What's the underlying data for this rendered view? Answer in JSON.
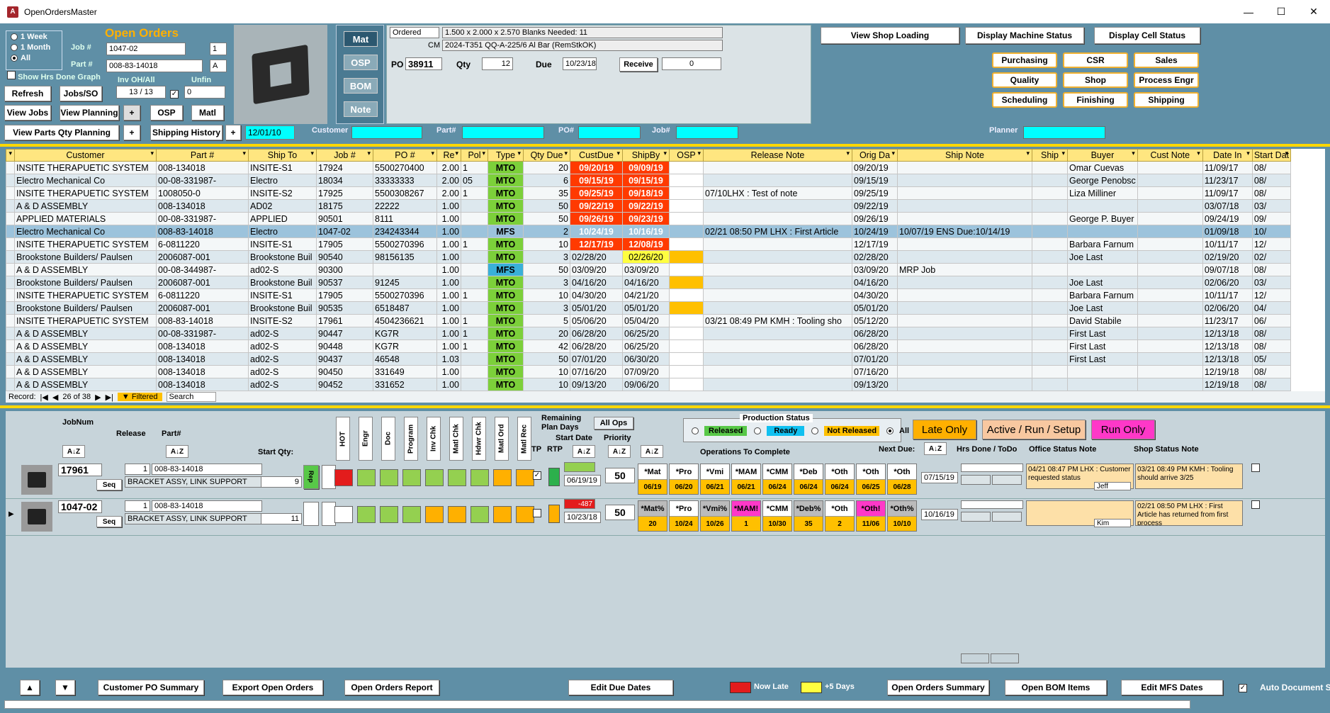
{
  "app": {
    "title": "OpenOrdersMaster",
    "icon": "A"
  },
  "filters": {
    "radio_1week": "1 Week",
    "radio_1month": "1 Month",
    "radio_all": "All",
    "show_hrs": "Show Hrs Done Graph",
    "job_label": "Job #",
    "job_value": "1047-02",
    "job_suffix": "1",
    "part_label": "Part #",
    "part_value": "008-83-14018",
    "part_suffix": "A",
    "inv_label": "Inv OH/All",
    "inv_value": "13 / 13",
    "unfin_label": "Unfin",
    "unfin_value": "0",
    "date_value": "12/01/10",
    "customer_label": "Customer",
    "partnum_label": "Part#",
    "ponum_label": "PO#",
    "jobnum_label": "Job#",
    "planner_label": "Planner"
  },
  "title": "Open Orders",
  "buttons": {
    "refresh": "Refresh",
    "jobs_so": "Jobs/SO",
    "view_jobs": "View Jobs",
    "view_planning": "View Planning",
    "plus": "+",
    "osp": "OSP",
    "matl": "Matl",
    "view_parts_qty": "View Parts Qty Planning",
    "shipping_history": "Shipping History",
    "view_shop_loading": "View Shop Loading",
    "display_machine_status": "Display Machine Status",
    "display_cell_status": "Display Cell Status",
    "receive": "Receive"
  },
  "side_tabs": [
    "Mat",
    "OSP",
    "BOM",
    "Note"
  ],
  "po_panel": {
    "status": "Ordered",
    "spec": "1.500  x 2.000  x 2.570  Blanks Needed: 11",
    "cm_label": "CM",
    "material": "2024-T351 QQ-A-225/6 Al Bar (RemStkOK)",
    "po_label": "PO",
    "po_value": "38911",
    "qty_label": "Qty",
    "qty_value": "12",
    "due_label": "Due",
    "due_value": "10/23/18",
    "recv_value": "0"
  },
  "dept_buttons": [
    "Purchasing",
    "CSR",
    "Sales",
    "Quality",
    "Shop",
    "Process Engr",
    "Scheduling",
    "Finishing",
    "Shipping"
  ],
  "grid": {
    "headers": [
      "Customer",
      "Part #",
      "Ship To",
      "Job #",
      "PO #",
      "Re",
      "Pol",
      "Type",
      "Qty Due",
      "CustDue",
      "ShipBy",
      "OSP",
      "Release Note",
      "Orig Da",
      "Ship Note",
      "Ship",
      "Buyer",
      "Cust Note",
      "Date In",
      "Start Dat"
    ],
    "rows": [
      [
        "INSITE THERAPUETIC SYSTEM",
        "008-134018",
        "INSITE-S1",
        "17924",
        "5500270400",
        "2.00",
        "1",
        "MTO",
        "20",
        "09/20/19",
        "09/09/19",
        "",
        "",
        "09/20/19",
        "",
        "",
        "Omar Cuevas",
        "",
        "11/09/17",
        "08/"
      ],
      [
        "Electro Mechanical Co",
        "00-08-331987-",
        "Electro",
        "18034",
        "33333333",
        "2.00",
        "05",
        "MTO",
        "6",
        "09/15/19",
        "09/15/19",
        "",
        "",
        "09/15/19",
        "",
        "",
        "George Penobsc",
        "",
        "11/23/17",
        "08/"
      ],
      [
        "INSITE THERAPUETIC SYSTEM",
        "1008050-0",
        "INSITE-S2",
        "17925",
        "5500308267",
        "2.00",
        "1",
        "MTO",
        "35",
        "09/25/19",
        "09/18/19",
        "",
        "07/10LHX : Test of note",
        "09/25/19",
        "",
        "",
        "Liza Milliner",
        "",
        "11/09/17",
        "08/"
      ],
      [
        "A & D  ASSEMBLY",
        "008-134018",
        "AD02",
        "18175",
        "22222",
        "1.00",
        "",
        "MTO",
        "50",
        "09/22/19",
        "09/22/19",
        "",
        "",
        "09/22/19",
        "",
        "",
        "",
        "",
        "03/07/18",
        "03/"
      ],
      [
        "APPLIED MATERIALS",
        "00-08-331987-",
        "APPLIED",
        "90501",
        "8111",
        "1.00",
        "",
        "MTO",
        "50",
        "09/26/19",
        "09/23/19",
        "",
        "",
        "09/26/19",
        "",
        "",
        "George P. Buyer",
        "",
        "09/24/19",
        "09/"
      ],
      [
        "Electro Mechanical Co",
        "008-83-14018",
        "Electro",
        "1047-02",
        "234243344",
        "1.00",
        "",
        "MFS",
        "2",
        "10/24/19",
        "10/16/19",
        "",
        "02/21 08:50 PM LHX :  First Article",
        "10/24/19",
        "10/07/19 ENS Due:10/14/19",
        "",
        "",
        "",
        "01/09/18",
        "10/"
      ],
      [
        "INSITE THERAPUETIC SYSTEM",
        "6-0811220",
        "INSITE-S1",
        "17905",
        "5500270396",
        "1.00",
        "1",
        "MTO",
        "10",
        "12/17/19",
        "12/08/19",
        "",
        "",
        "12/17/19",
        "",
        "",
        "Barbara Farnum",
        "",
        "10/11/17",
        "12/"
      ],
      [
        "Brookstone Builders/ Paulsen",
        "2006087-001",
        "Brookstone Buil",
        "90540",
        "98156135",
        "1.00",
        "",
        "MTO",
        "3",
        "02/28/20",
        "02/26/20",
        "",
        "",
        "02/28/20",
        "",
        "",
        "Joe Last",
        "",
        "02/19/20",
        "02/"
      ],
      [
        "A & D  ASSEMBLY",
        "00-08-344987-",
        "ad02-S",
        "90300",
        "",
        "1.00",
        "",
        "MFS",
        "50",
        "03/09/20",
        "03/09/20",
        "",
        "",
        "03/09/20",
        "MRP Job",
        "",
        "",
        "",
        "09/07/18",
        "08/"
      ],
      [
        "Brookstone Builders/ Paulsen",
        "2006087-001",
        "Brookstone Buil",
        "90537",
        "91245",
        "1.00",
        "",
        "MTO",
        "3",
        "04/16/20",
        "04/16/20",
        "",
        "",
        "04/16/20",
        "",
        "",
        "Joe Last",
        "",
        "02/06/20",
        "03/"
      ],
      [
        "INSITE THERAPUETIC SYSTEM",
        "6-0811220",
        "INSITE-S1",
        "17905",
        "5500270396",
        "1.00",
        "1",
        "MTO",
        "10",
        "04/30/20",
        "04/21/20",
        "",
        "",
        "04/30/20",
        "",
        "",
        "Barbara Farnum",
        "",
        "10/11/17",
        "12/"
      ],
      [
        "Brookstone Builders/ Paulsen",
        "2006087-001",
        "Brookstone Buil",
        "90535",
        "6518487",
        "1.00",
        "",
        "MTO",
        "3",
        "05/01/20",
        "05/01/20",
        "",
        "",
        "05/01/20",
        "",
        "",
        "Joe Last",
        "",
        "02/06/20",
        "04/"
      ],
      [
        "INSITE THERAPUETIC SYSTEM",
        "008-83-14018",
        "INSITE-S2",
        "17961",
        "4504236621",
        "1.00",
        "1",
        "MTO",
        "5",
        "05/06/20",
        "05/04/20",
        "",
        "03/21 08:49 PM KMH : Tooling sho",
        "05/12/20",
        "",
        "",
        "David Stabile",
        "",
        "11/23/17",
        "06/"
      ],
      [
        "A & D  ASSEMBLY",
        "00-08-331987-",
        "ad02-S",
        "90447",
        "KG7R",
        "1.00",
        "1",
        "MTO",
        "20",
        "06/28/20",
        "06/25/20",
        "",
        "",
        "06/28/20",
        "",
        "",
        "First Last",
        "",
        "12/13/18",
        "08/"
      ],
      [
        "A & D  ASSEMBLY",
        "008-134018",
        "ad02-S",
        "90448",
        "KG7R",
        "1.00",
        "1",
        "MTO",
        "42",
        "06/28/20",
        "06/25/20",
        "",
        "",
        "06/28/20",
        "",
        "",
        "First Last",
        "",
        "12/13/18",
        "08/"
      ],
      [
        "A & D  ASSEMBLY",
        "008-134018",
        "ad02-S",
        "90437",
        "46548",
        "1.03",
        "",
        "MTO",
        "50",
        "07/01/20",
        "06/30/20",
        "",
        "",
        "07/01/20",
        "",
        "",
        "First Last",
        "",
        "12/13/18",
        "05/"
      ],
      [
        "A & D  ASSEMBLY",
        "008-134018",
        "ad02-S",
        "90450",
        "331649",
        "1.00",
        "",
        "MTO",
        "10",
        "07/16/20",
        "07/09/20",
        "",
        "",
        "07/16/20",
        "",
        "",
        "",
        "",
        "12/19/18",
        "08/"
      ],
      [
        "A & D  ASSEMBLY",
        "008-134018",
        "ad02-S",
        "90452",
        "331652",
        "1.00",
        "",
        "MTO",
        "10",
        "09/13/20",
        "09/06/20",
        "",
        "",
        "09/13/20",
        "",
        "",
        "",
        "",
        "12/19/18",
        "08/"
      ]
    ]
  },
  "recnav": {
    "record_label": "Record:",
    "position": "26 of 38",
    "filtered": "Filtered",
    "search": "Search"
  },
  "bottom": {
    "jobnum": "JobNum",
    "release": "Release",
    "partnum": "Part#",
    "start_qty": "Start Qty:",
    "checks": [
      "HOT",
      "Engr",
      "Doc",
      "Program",
      "Inv Chk",
      "Matl Chk",
      "Hdwr Chk",
      "Matl Ord",
      "Matl Rec"
    ],
    "remaining": "Remaining",
    "plan_days": "Plan Days",
    "start_date": "Start Date",
    "priority": "Priority",
    "tp": "TP",
    "rtp": "RTP",
    "all_ops": "All Ops",
    "prod_status": "Production Status",
    "released": "Released",
    "ready": "Ready",
    "not_released": "Not Released",
    "all": "All",
    "late_only": "Late Only",
    "active_run": "Active / Run / Setup",
    "run_only": "Run Only",
    "ops_to_complete": "Operations To Complete",
    "next_due": "Next Due:",
    "hrs_done": "Hrs Done / ToDo",
    "office_note": "Office Status Note",
    "shop_note": "Shop Status Note",
    "seq": "Seq",
    "rep": "Rep"
  },
  "jobs": [
    {
      "job": "17961",
      "release": "1",
      "part": "008-83-14018",
      "desc": "BRACKET ASSY, LINK SUPPORT",
      "qty": "9",
      "plan": "",
      "start": "06/19/19",
      "priority": "50",
      "next_due": "07/15/19",
      "ops": [
        [
          "*Mat",
          "06/19"
        ],
        [
          "*Pro",
          "06/20"
        ],
        [
          "*Vmi",
          "06/21"
        ],
        [
          "*MAM",
          "06/21"
        ],
        [
          "*CMM",
          "06/24"
        ],
        [
          "*Deb",
          "06/24"
        ],
        [
          "*Oth",
          "06/24"
        ],
        [
          "*Oth",
          "06/25"
        ],
        [
          "*Oth",
          "06/28"
        ]
      ],
      "office": "04/21 08:47 PM LHX : Customer requested status",
      "office_user": "Jeff",
      "shop": "03/21 08:49 PM KMH : Tooling should arrive 3/25"
    },
    {
      "job": "1047-02",
      "release": "1",
      "part": "008-83-14018",
      "desc": "BRACKET ASSY, LINK SUPPORT",
      "qty": "11",
      "plan": "-487",
      "start": "10/23/18",
      "priority": "50",
      "next_due": "10/16/19",
      "ops": [
        [
          "*Mat%",
          "20"
        ],
        [
          "*Pro",
          "10/24"
        ],
        [
          "*Vmi%",
          "10/26"
        ],
        [
          "*MAM!",
          "1"
        ],
        [
          "*CMM",
          "10/30"
        ],
        [
          "*Deb%",
          "35"
        ],
        [
          "*Oth",
          "2"
        ],
        [
          "*Oth!",
          "11/06"
        ],
        [
          "*Oth%",
          "10/10"
        ]
      ],
      "office": "",
      "office_user": "Kim",
      "shop": "02/21 08:50 PM LHX :  First Article has returned from first process"
    }
  ],
  "footer": {
    "customer_po": "Customer PO Summary",
    "export": "Export Open Orders",
    "report": "Open Orders Report",
    "edit_due": "Edit Due Dates",
    "now_late": "Now Late",
    "plus5": "+5 Days",
    "summary": "Open Orders Summary",
    "bom_items": "Open BOM Items",
    "edit_mfs": "Edit MFS Dates",
    "auto_doc": "Auto Document S"
  },
  "colors": {
    "bg": "#5f8fa6",
    "accent": "#ffb000",
    "late": "#e31c1c",
    "warn": "#ffff40",
    "mto": "#7cd03a",
    "mfs": "#3ab0d8"
  }
}
